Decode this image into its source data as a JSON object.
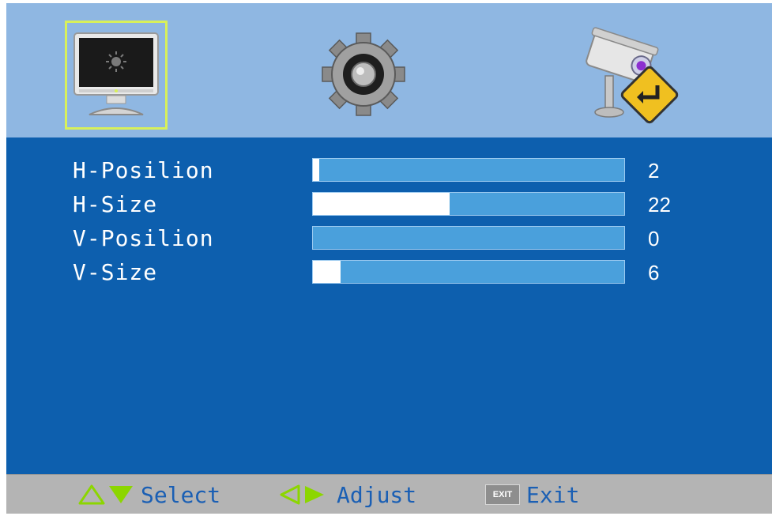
{
  "tabs": [
    {
      "icon": "monitor-icon",
      "selected": true
    },
    {
      "icon": "gear-icon",
      "selected": false
    },
    {
      "icon": "camera-return-icon",
      "selected": false
    }
  ],
  "settings": [
    {
      "label": "H-Posilion",
      "value": "2",
      "fill_fraction": 0.02
    },
    {
      "label": "H-Size",
      "value": "22",
      "fill_fraction": 0.44
    },
    {
      "label": "V-Posilion",
      "value": "0",
      "fill_fraction": 0.0
    },
    {
      "label": "V-Size",
      "value": "6",
      "fill_fraction": 0.09
    }
  ],
  "footer": {
    "select_label": "Select",
    "adjust_label": "Adjust",
    "exit_key_label": "EXIT",
    "exit_label": "Exit"
  },
  "colors": {
    "panel_blue": "#0d5fae",
    "header_blue": "#8fb7e2",
    "bar_blue": "#4aa0dc",
    "selection_green": "#d8f05a",
    "arrow_green": "#8cd600",
    "footer_grey": "#b4b4b4",
    "hint_text": "#1a5fb4"
  }
}
